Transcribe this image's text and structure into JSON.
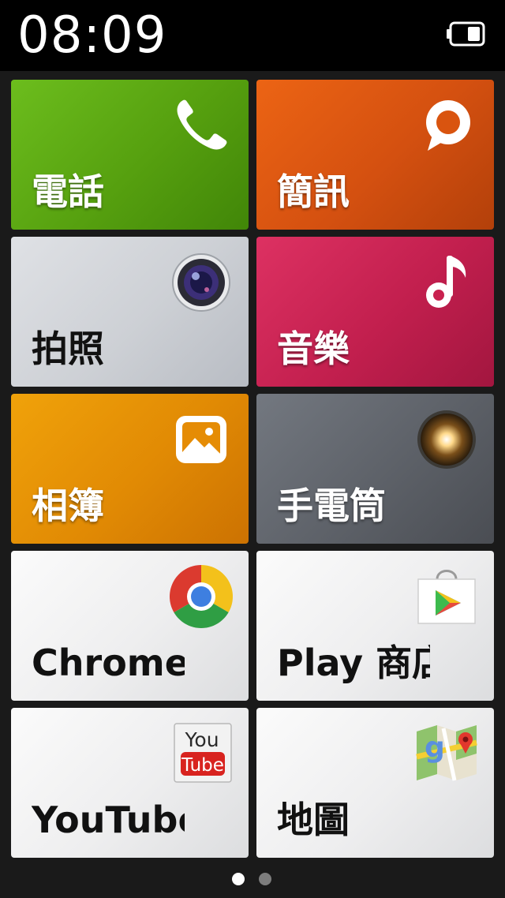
{
  "status_bar": {
    "time": "08:09",
    "battery_icon": "battery-icon"
  },
  "tiles": [
    {
      "label": "電話",
      "icon": "phone-icon",
      "color": "#5aa812"
    },
    {
      "label": "簡訊",
      "icon": "chat-bubble-icon",
      "color": "#d9540f"
    },
    {
      "label": "拍照",
      "icon": "camera-lens-icon",
      "color": "#cfd2d7"
    },
    {
      "label": "音樂",
      "icon": "music-note-icon",
      "color": "#c9214f"
    },
    {
      "label": "相簿",
      "icon": "picture-icon",
      "color": "#e58c05"
    },
    {
      "label": "手電筒",
      "icon": "flashlight-icon",
      "color": "#606369"
    },
    {
      "label": "Chrome",
      "icon": "chrome-icon",
      "color": "#efeff0"
    },
    {
      "label": "Play 商店",
      "icon": "play-store-icon",
      "color": "#efeff0"
    },
    {
      "label": "YouTube",
      "icon": "youtube-icon",
      "color": "#efeff0"
    },
    {
      "label": "地圖",
      "icon": "maps-icon",
      "color": "#efeff0"
    }
  ],
  "youtube_logo": {
    "top": "You",
    "bottom": "Tube"
  },
  "pager": {
    "pages": 2,
    "current": 1
  }
}
